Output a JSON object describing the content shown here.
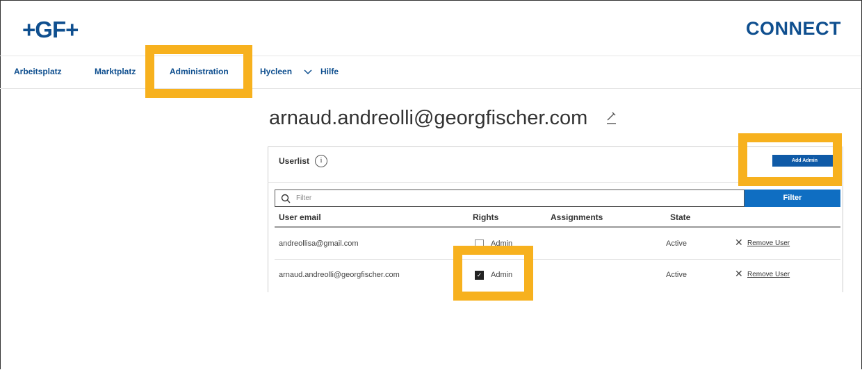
{
  "header": {
    "logo": "+GF+",
    "brand": "CONNECT"
  },
  "nav": {
    "items": [
      "Arbeitsplatz",
      "Marktplatz",
      "Administration",
      "Hycleen",
      "Hilfe"
    ],
    "dropdown_icon": "chevron-down-icon"
  },
  "page": {
    "title": "arnaud.andreolli@georgfischer.com",
    "edit_icon": "pencil-icon"
  },
  "userlist": {
    "title": "Userlist",
    "info_icon_label": "i",
    "add_admin_label": "Add Admin",
    "filter_placeholder": "Filter",
    "filter_button": "Filter",
    "columns": [
      "User email",
      "Rights",
      "Assignments",
      "State"
    ],
    "rows": [
      {
        "email": "andreollisa@gmail.com",
        "rights": "Admin",
        "admin_checked": false,
        "assignments": "",
        "state": "Active",
        "action": "Remove User"
      },
      {
        "email": "arnaud.andreolli@georgfischer.com",
        "rights": "Admin",
        "admin_checked": true,
        "assignments": "",
        "state": "Active",
        "action": "Remove User"
      }
    ]
  },
  "colors": {
    "brand_blue": "#0f4f8f",
    "button_blue": "#0f6ec2",
    "highlight": "#f7b11e"
  }
}
